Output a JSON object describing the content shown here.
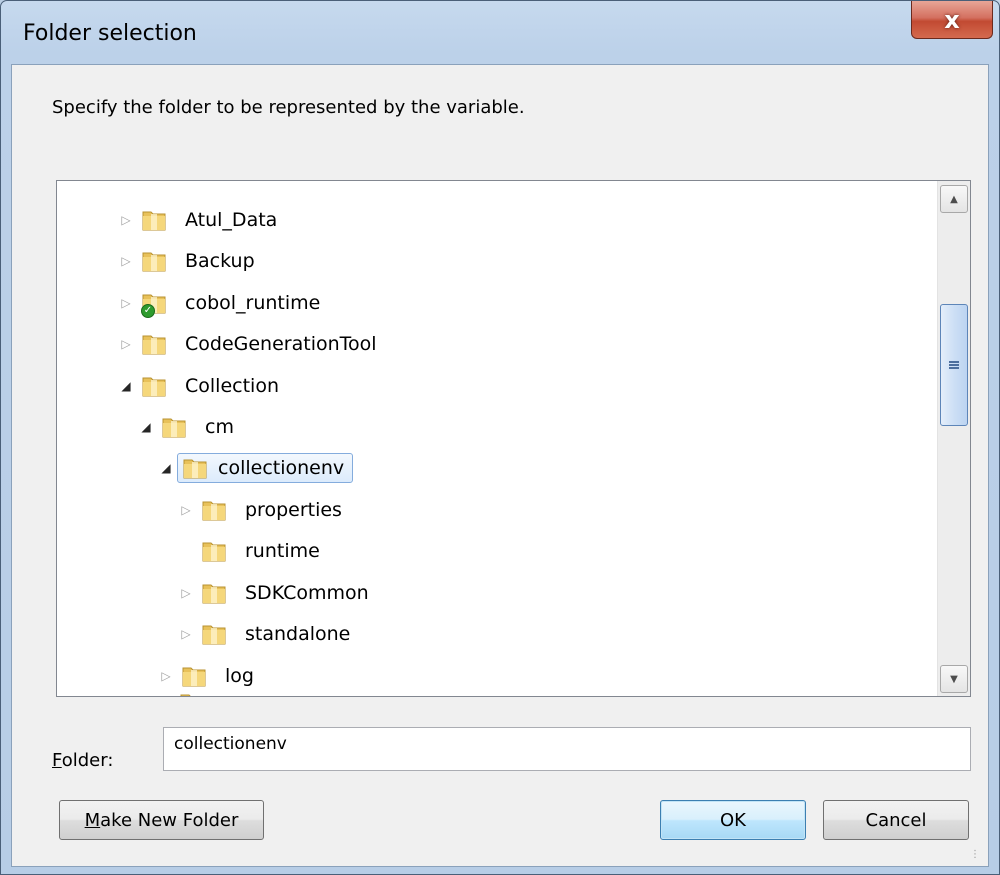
{
  "dialog": {
    "title": "Folder selection",
    "close_label": "x",
    "instruction": "Specify the folder to be represented by the variable."
  },
  "tree": {
    "items": [
      {
        "label": "Atul_Data",
        "expanded": false,
        "has_children": true
      },
      {
        "label": "Backup",
        "expanded": false,
        "has_children": true
      },
      {
        "label": "cobol_runtime",
        "expanded": false,
        "has_children": true,
        "badge": "green-check"
      },
      {
        "label": "CodeGenerationTool",
        "expanded": false,
        "has_children": true
      },
      {
        "label": "Collection",
        "expanded": true,
        "has_children": true
      },
      {
        "label": "cm",
        "expanded": true,
        "has_children": true
      },
      {
        "label": "collectionenv",
        "expanded": true,
        "has_children": true,
        "selected": true
      },
      {
        "label": "properties",
        "expanded": false,
        "has_children": true
      },
      {
        "label": "runtime",
        "expanded": false,
        "has_children": false
      },
      {
        "label": "SDKCommon",
        "expanded": false,
        "has_children": true
      },
      {
        "label": "standalone",
        "expanded": false,
        "has_children": true
      },
      {
        "label": "log",
        "expanded": false,
        "has_children": true
      }
    ]
  },
  "folder_field": {
    "label_prefix": "F",
    "label_rest": "older:",
    "value": "collectionenv"
  },
  "buttons": {
    "make_new_folder_prefix": "M",
    "make_new_folder_rest": "ake New Folder",
    "ok": "OK",
    "cancel": "Cancel"
  },
  "colors": {
    "close_button": "#c24a32",
    "selection_border": "#84acdd",
    "folder_yellow": "#e8c15a"
  }
}
